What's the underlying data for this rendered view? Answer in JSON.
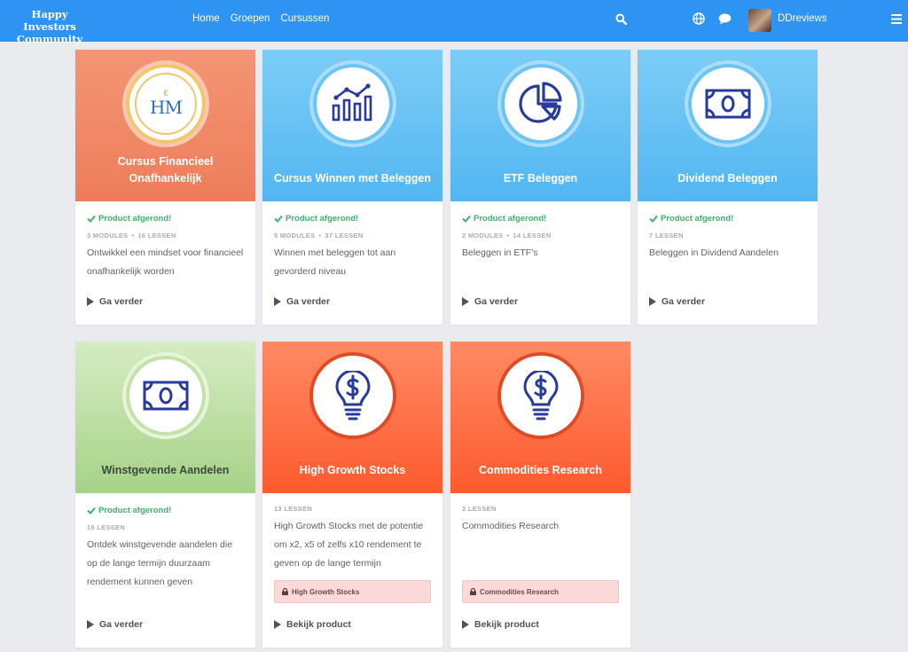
{
  "header": {
    "brand": "Happy Investors Community",
    "nav": [
      "Home",
      "Groepen",
      "Cursussen"
    ],
    "user": "DDreviews",
    "icons": [
      "search-icon",
      "globe-icon",
      "chat-icon",
      "menu-icon"
    ]
  },
  "colors": {
    "topbar": "#2d94f4",
    "salmon": "#f08462",
    "sky": "#5cbcf3",
    "green": "#a8d38a",
    "orange": "#fd6136",
    "done": "#3cb26b"
  },
  "cards": [
    {
      "title": "Cursus Financieel Onafhankelijk",
      "icon": "hm-logo",
      "logo_text": "HM",
      "done": "Product afgerond!",
      "modules": "3 MODULES",
      "lessons": "16 LESSEN",
      "desc": "Ontwikkel een mindset voor financieel onafhankelijk worden",
      "action": "Ga verder"
    },
    {
      "title": "Cursus Winnen met Beleggen",
      "icon": "bar-chart-icon",
      "done": "Product afgerond!",
      "modules": "5 MODULES",
      "lessons": "37 LESSEN",
      "desc": "Winnen met beleggen tot aan gevorderd niveau",
      "action": "Ga verder"
    },
    {
      "title": "ETF Beleggen",
      "icon": "pie-chart-icon",
      "done": "Product afgerond!",
      "modules": "2 MODULES",
      "lessons": "14 LESSEN",
      "desc": "Beleggen in ETF's",
      "action": "Ga verder"
    },
    {
      "title": "Dividend Beleggen",
      "icon": "banknote-icon",
      "done": "Product afgerond!",
      "lessons": "7 LESSEN",
      "desc": "Beleggen in Dividend Aandelen",
      "action": "Ga verder"
    },
    {
      "title": "Winstgevende Aandelen",
      "icon": "banknote-icon",
      "done": "Product afgerond!",
      "lessons": "16 LESSEN",
      "desc": "Ontdek winstgevende aandelen die op de lange termijn duurzaam rendement kunnen geven",
      "action": "Ga verder"
    },
    {
      "title": "High Growth Stocks",
      "icon": "lightbulb-dollar-icon",
      "lessons": "13 LESSEN",
      "desc": "High Growth Stocks met de potentie om x2, x5 of zelfs x10 rendement te geven op de lange termijn",
      "locked": "High Growth Stocks",
      "action": "Bekijk product"
    },
    {
      "title": "Commodities Research",
      "icon": "lightbulb-dollar-icon",
      "lessons": "2 LESSEN",
      "desc": "Commodities Research",
      "locked": "Commodities Research",
      "action": "Bekijk product"
    }
  ]
}
